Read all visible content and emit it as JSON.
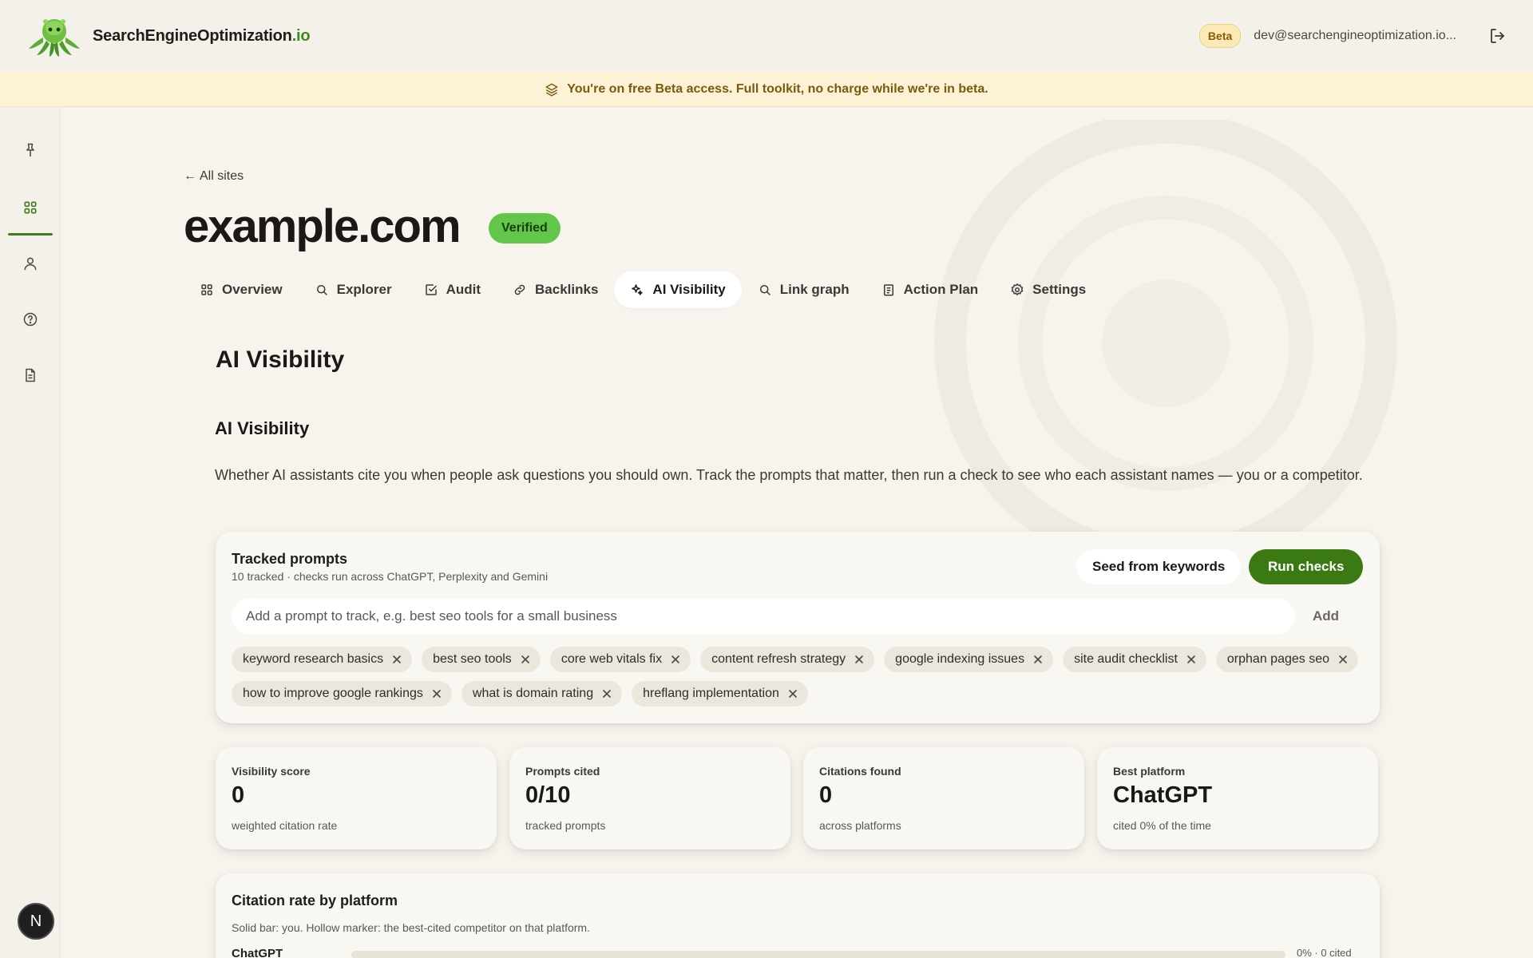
{
  "brand": {
    "name_main": "SearchEngineOptimization",
    "name_tld": ".io",
    "logo_icon": "octopus-logo-icon"
  },
  "header": {
    "beta_label": "Beta",
    "user_email": "dev@searchengineoptimization.io...",
    "logout_icon": "logout-icon"
  },
  "banner": {
    "icon": "layers-icon",
    "text": "You're on free Beta access. Full toolkit, no charge while we're in beta."
  },
  "sidebar": {
    "items": [
      {
        "icon": "pin-icon"
      },
      {
        "icon": "grid-icon",
        "active": true
      },
      {
        "icon": "user-icon"
      },
      {
        "icon": "help-icon"
      },
      {
        "icon": "document-icon"
      }
    ],
    "bottom_avatar": "N"
  },
  "page": {
    "back_label": "All sites",
    "site_title": "example.com",
    "verified_label": "Verified"
  },
  "tabs": [
    {
      "label": "Overview",
      "icon": "grid-icon"
    },
    {
      "label": "Explorer",
      "icon": "search-icon"
    },
    {
      "label": "Audit",
      "icon": "checkbox-icon"
    },
    {
      "label": "Backlinks",
      "icon": "link-icon"
    },
    {
      "label": "AI Visibility",
      "icon": "sparkle-icon",
      "active": true
    },
    {
      "label": "Link graph",
      "icon": "search-icon"
    },
    {
      "label": "Action Plan",
      "icon": "clipboard-icon"
    },
    {
      "label": "Settings",
      "icon": "gear-icon"
    }
  ],
  "section": {
    "heading": "AI Visibility",
    "subheading": "AI Visibility",
    "description": "Whether AI assistants cite you when people ask questions you should own. Track the prompts that matter, then run a check to see who each assistant names — you or a competitor."
  },
  "tracked": {
    "title": "Tracked prompts",
    "subtitle": "10 tracked · checks run across ChatGPT, Perplexity and Gemini",
    "seed_label": "Seed from keywords",
    "run_label": "Run checks",
    "input_placeholder": "Add a prompt to track, e.g. best seo tools for a small business",
    "add_label": "Add",
    "chips": [
      "keyword research basics",
      "best seo tools",
      "core web vitals fix",
      "content refresh strategy",
      "google indexing issues",
      "site audit checklist",
      "orphan pages seo",
      "how to improve google rankings",
      "what is domain rating",
      "hreflang implementation"
    ]
  },
  "stats": [
    {
      "label": "Visibility score",
      "value": "0",
      "sub": "weighted citation rate"
    },
    {
      "label": "Prompts cited",
      "value": "0/10",
      "sub": "tracked prompts"
    },
    {
      "label": "Citations found",
      "value": "0",
      "sub": "across platforms"
    },
    {
      "label": "Best platform",
      "value": "ChatGPT",
      "sub": "cited 0% of the time"
    }
  ],
  "citation": {
    "title": "Citation rate by platform",
    "subtitle": "Solid bar: you. Hollow marker: the best-cited competitor on that platform.",
    "rows": [
      {
        "platform": "ChatGPT",
        "rate": 0,
        "value_label": "0% · 0 cited"
      }
    ]
  },
  "colors": {
    "accent": "#3b7a12",
    "verified": "#62c64a",
    "banner_bg": "#fcf2d6",
    "beta_bg": "#fbeab8"
  }
}
